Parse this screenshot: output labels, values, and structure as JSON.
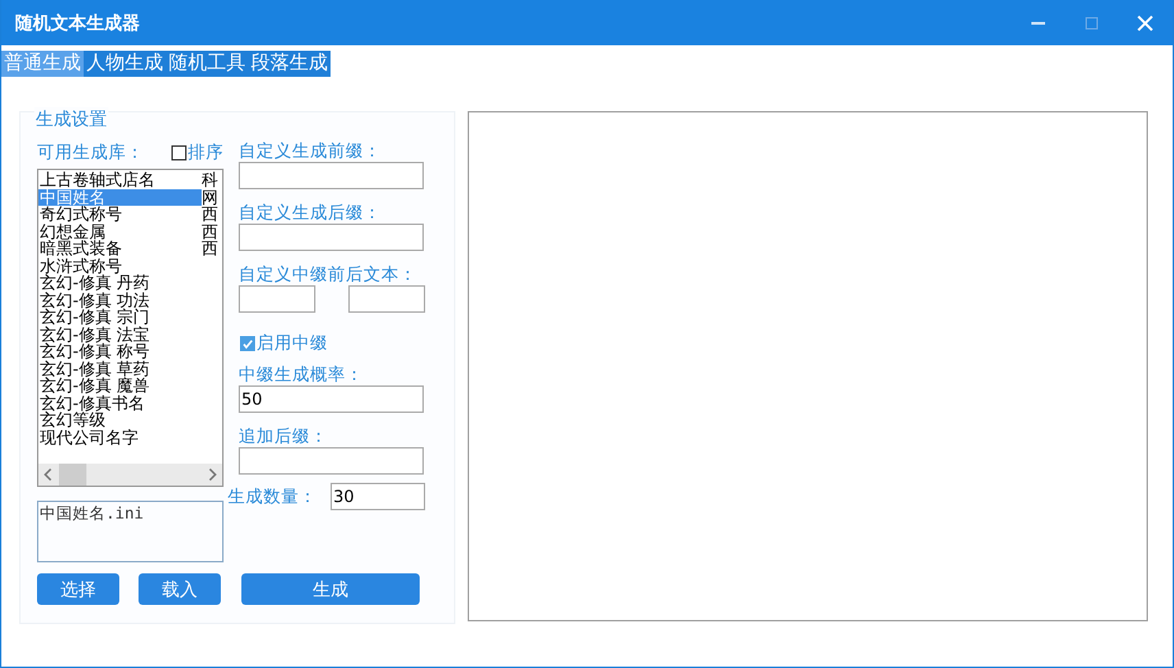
{
  "window": {
    "title": "随机文本生成器"
  },
  "tabs": [
    {
      "label": "普通生成",
      "selected": true
    },
    {
      "label": "人物生成",
      "selected": false
    },
    {
      "label": "随机工具",
      "selected": false
    },
    {
      "label": "段落生成",
      "selected": false
    }
  ],
  "settings": {
    "title": "生成设置",
    "library_label": "可用生成库：",
    "sort": {
      "label": "排序",
      "checked": false
    },
    "library": [
      {
        "name": "上古卷轴式店名",
        "column_2": "科",
        "selected": false
      },
      {
        "name": "中国姓名",
        "column_2": "网",
        "selected": true
      },
      {
        "name": "奇幻式称号",
        "column_2": "西",
        "selected": false
      },
      {
        "name": "幻想金属",
        "column_2": "西",
        "selected": false
      },
      {
        "name": "暗黑式装备",
        "column_2": "西",
        "selected": false
      },
      {
        "name": "水浒式称号",
        "selected": false
      },
      {
        "name": "玄幻-修真 丹药",
        "selected": false
      },
      {
        "name": "玄幻-修真 功法",
        "selected": false
      },
      {
        "name": "玄幻-修真 宗门",
        "selected": false
      },
      {
        "name": "玄幻-修真 法宝",
        "selected": false
      },
      {
        "name": "玄幻-修真 称号",
        "selected": false
      },
      {
        "name": "玄幻-修真 草药",
        "selected": false
      },
      {
        "name": "玄幻-修真 魔兽",
        "selected": false
      },
      {
        "name": "玄幻-修真书名",
        "selected": false
      },
      {
        "name": "玄幻等级",
        "selected": false
      },
      {
        "name": "现代公司名字",
        "selected": false
      }
    ],
    "file_value": "中国姓名.ini",
    "prefix_label": "自定义生成前缀：",
    "suffix_label": "自定义生成后缀：",
    "infix_label": "自定义中缀前后文本：",
    "enable_infix": {
      "label": "启用中缀",
      "checked": true
    },
    "infix_rate_label": "中缀生成概率：",
    "infix_rate_value": "50",
    "append_suffix_label": "追加后缀：",
    "count_label": "生成数量：",
    "count_value": "30",
    "buttons": {
      "choose": "选择",
      "load": "载入",
      "generate": "生成"
    }
  }
}
